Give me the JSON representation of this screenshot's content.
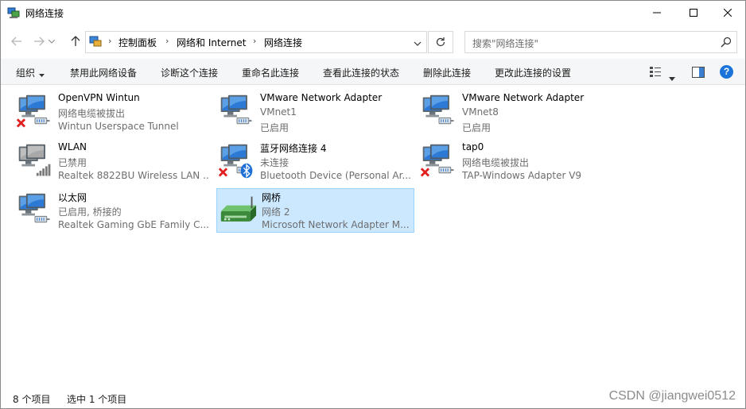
{
  "window": {
    "title": "网络连接"
  },
  "address": {
    "crumbs": [
      "控制面板",
      "网络和 Internet",
      "网络连接"
    ]
  },
  "search": {
    "placeholder": "搜索\"网络连接\""
  },
  "toolbar": {
    "organize": "组织",
    "disable": "禁用此网络设备",
    "diagnose": "诊断这个连接",
    "rename": "重命名此连接",
    "status": "查看此连接的状态",
    "delete": "删除此连接",
    "settings": "更改此连接的设置"
  },
  "items": [
    {
      "name": "OpenVPN Wintun",
      "status": "网络电缆被拔出",
      "device": "Wintun Userspace Tunnel",
      "badge": "x",
      "kind": "lan"
    },
    {
      "name": "VMware Network Adapter",
      "status": "VMnet1",
      "device": "已启用",
      "badge": "",
      "kind": "lan"
    },
    {
      "name": "VMware Network Adapter",
      "status": "VMnet8",
      "device": "已启用",
      "badge": "",
      "kind": "lan"
    },
    {
      "name": "WLAN",
      "status": "已禁用",
      "device": "Realtek 8822BU Wireless LAN ...",
      "badge": "",
      "kind": "wlan"
    },
    {
      "name": "蓝牙网络连接 4",
      "status": "未连接",
      "device": "Bluetooth Device (Personal Ar...",
      "badge": "x-bt",
      "kind": "lan"
    },
    {
      "name": "tap0",
      "status": "网络电缆被拔出",
      "device": "TAP-Windows Adapter V9",
      "badge": "x",
      "kind": "lan"
    },
    {
      "name": "以太网",
      "status": "已启用, 桥接的",
      "device": "Realtek Gaming GbE Family C...",
      "badge": "",
      "kind": "lan"
    },
    {
      "name": "网桥",
      "status": "网络 2",
      "device": "Microsoft Network Adapter M...",
      "badge": "",
      "kind": "bridge",
      "selected": true
    }
  ],
  "statusbar": {
    "count": "8 个项目",
    "selected": "选中 1 个项目"
  },
  "watermark": "CSDN @jiangwei0512",
  "colors": {
    "accent": "#1a73d9",
    "selection_bg": "#cce8ff",
    "selection_border": "#99d1ff",
    "error_red": "#e02020"
  }
}
